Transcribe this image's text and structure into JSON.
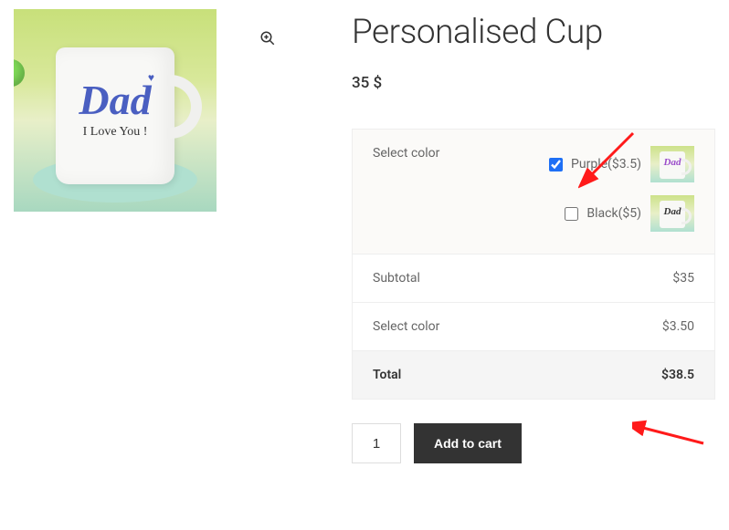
{
  "product": {
    "title": "Personalised Cup",
    "price": "35 $",
    "mug_text_main": "Dad",
    "mug_text_sub": "I Love You !"
  },
  "options": {
    "select_color_label": "Select color",
    "items": [
      {
        "label": "Purple($3.5)",
        "checked": true,
        "swatch_text": "Dad",
        "swatch_color": "purple"
      },
      {
        "label": "Black($5)",
        "checked": false,
        "swatch_text": "Dad",
        "swatch_color": "black"
      }
    ]
  },
  "summary": {
    "subtotal_label": "Subtotal",
    "subtotal_value": "$35",
    "addon_label": "Select color",
    "addon_value": "$3.50",
    "total_label": "Total",
    "total_value": "$38.5"
  },
  "cart": {
    "quantity": "1",
    "add_button_label": "Add to cart"
  },
  "icons": {
    "zoom": "zoom-in-icon"
  }
}
